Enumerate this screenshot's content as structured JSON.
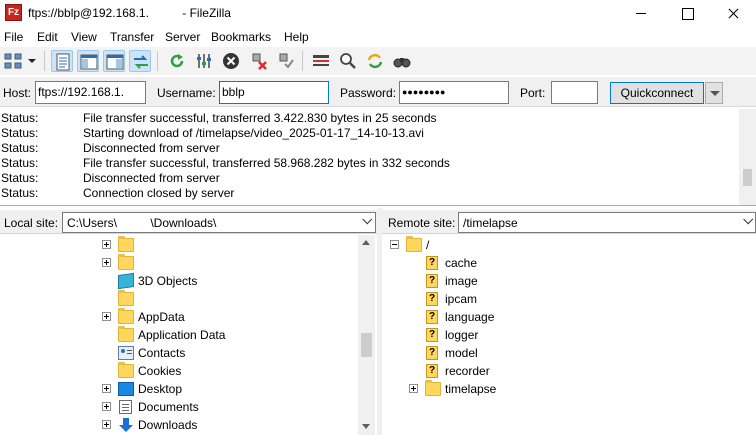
{
  "window": {
    "title": "ftps://bblp@192.168.1.          - FileZilla",
    "app_icon_letter": "Fz"
  },
  "menu": [
    {
      "label": "File"
    },
    {
      "label": "Edit"
    },
    {
      "label": "View"
    },
    {
      "label": "Transfer"
    },
    {
      "label": "Server"
    },
    {
      "label": "Bookmarks"
    },
    {
      "label": "Help"
    }
  ],
  "toolbar": {
    "icons": [
      "site-manager-icon",
      "toggle-message-log-icon",
      "toggle-local-tree-icon",
      "toggle-remote-tree-icon",
      "toggle-transfer-queue-icon",
      "refresh-icon",
      "process-queue-icon",
      "cancel-icon",
      "disconnect-icon",
      "reconnect-icon",
      "directory-filters-icon",
      "search-remote-icon",
      "sync-browsing-icon",
      "compare-directories-icon"
    ]
  },
  "quickconnect": {
    "host_label": "Host:",
    "host_value": "ftps://192.168.1.",
    "username_label": "Username:",
    "username_value": "bblp",
    "password_label": "Password:",
    "password_value": "●●●●●●●●",
    "port_label": "Port:",
    "port_value": "",
    "button_label": "Quickconnect"
  },
  "log": [
    {
      "kind": "Status:",
      "text": "File transfer successful, transferred 3.422.830 bytes in 25 seconds"
    },
    {
      "kind": "Status:",
      "text": "Starting download of /timelapse/video_2025-01-17_14-10-13.avi"
    },
    {
      "kind": "Status:",
      "text": "Disconnected from server"
    },
    {
      "kind": "Status:",
      "text": "File transfer successful, transferred 58.968.282 bytes in 332 seconds"
    },
    {
      "kind": "Status:",
      "text": "Disconnected from server"
    },
    {
      "kind": "Status:",
      "text": "Connection closed by server"
    }
  ],
  "local": {
    "label": "Local site:",
    "path": "C:\\Users\\          \\Downloads\\",
    "tree": [
      {
        "label": "",
        "expander": "plus",
        "icon": "folder-icon"
      },
      {
        "label": "",
        "expander": "plus",
        "icon": "folder-icon"
      },
      {
        "label": "3D Objects",
        "expander": "",
        "icon": "3d-objects-icon"
      },
      {
        "label": "",
        "expander": "",
        "icon": "folder-icon"
      },
      {
        "label": "AppData",
        "expander": "plus",
        "icon": "folder-icon"
      },
      {
        "label": "Application Data",
        "expander": "",
        "icon": "folder-icon"
      },
      {
        "label": "Contacts",
        "expander": "",
        "icon": "contacts-icon"
      },
      {
        "label": "Cookies",
        "expander": "",
        "icon": "folder-icon"
      },
      {
        "label": "Desktop",
        "expander": "plus",
        "icon": "desktop-icon"
      },
      {
        "label": "Documents",
        "expander": "plus",
        "icon": "documents-icon"
      },
      {
        "label": "Downloads",
        "expander": "plus",
        "icon": "downloads-icon"
      }
    ]
  },
  "remote": {
    "label": "Remote site:",
    "path": "/timelapse",
    "tree": [
      {
        "label": "/",
        "expander": "minus",
        "icon": "folder-icon",
        "depth": 0
      },
      {
        "label": "cache",
        "expander": "",
        "icon": "unknown-folder-icon",
        "depth": 1
      },
      {
        "label": "image",
        "expander": "",
        "icon": "unknown-folder-icon",
        "depth": 1
      },
      {
        "label": "ipcam",
        "expander": "",
        "icon": "unknown-folder-icon",
        "depth": 1
      },
      {
        "label": "language",
        "expander": "",
        "icon": "unknown-folder-icon",
        "depth": 1
      },
      {
        "label": "logger",
        "expander": "",
        "icon": "unknown-folder-icon",
        "depth": 1
      },
      {
        "label": "model",
        "expander": "",
        "icon": "unknown-folder-icon",
        "depth": 1
      },
      {
        "label": "recorder",
        "expander": "",
        "icon": "unknown-folder-icon",
        "depth": 1
      },
      {
        "label": "timelapse",
        "expander": "plus",
        "icon": "folder-icon",
        "depth": 1
      }
    ],
    "unknown_mark": "?"
  }
}
